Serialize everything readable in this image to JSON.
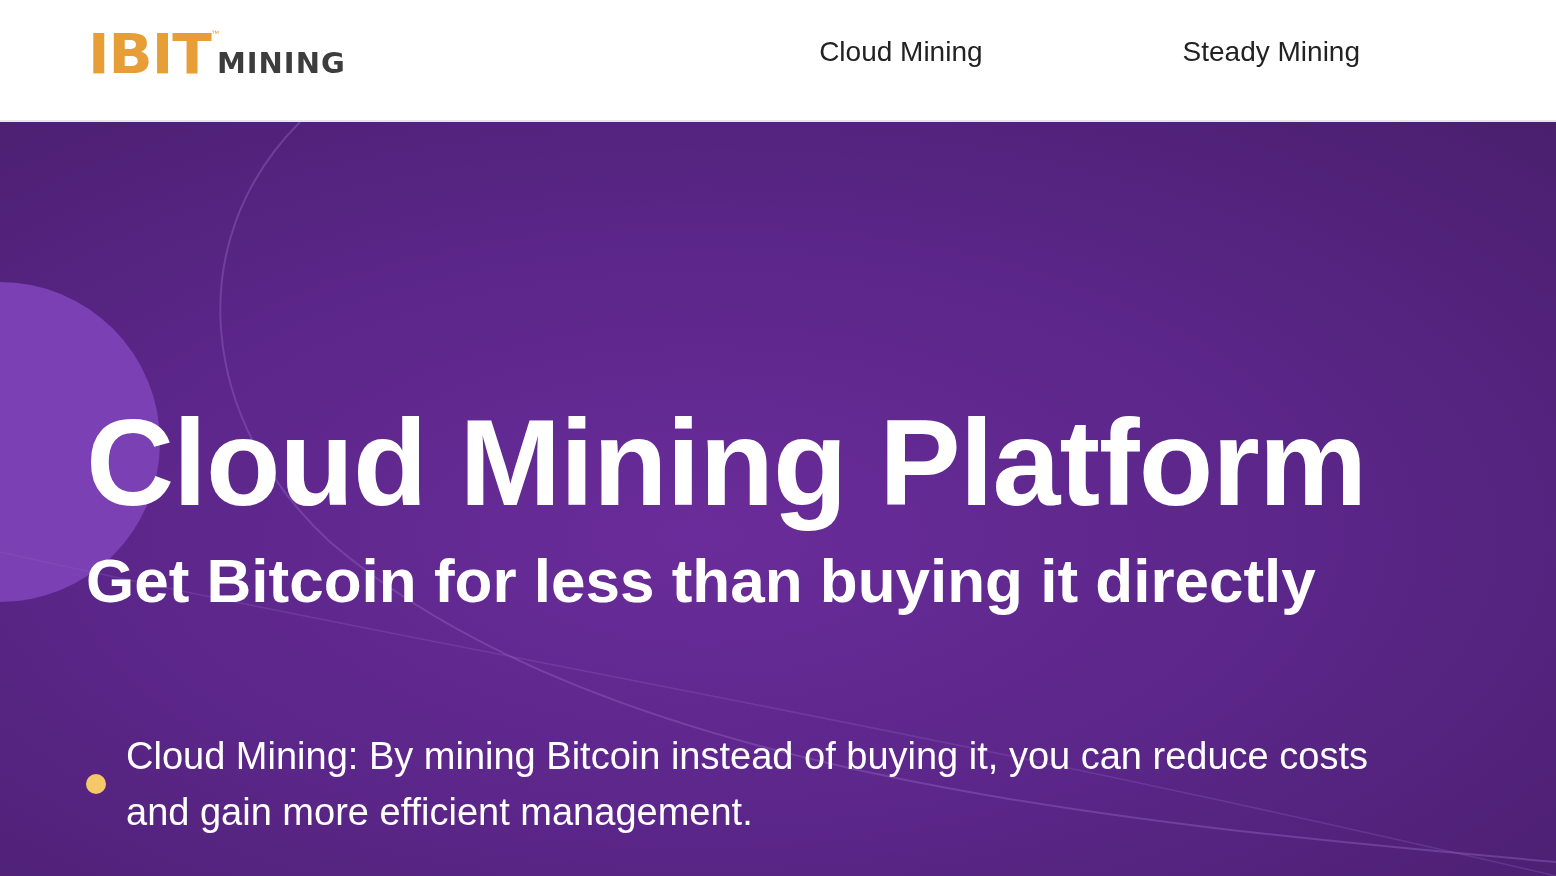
{
  "header": {
    "logo": {
      "primary": "IBIT",
      "trademark": "™",
      "secondary": "MINING"
    },
    "nav": [
      {
        "label": "Cloud Mining"
      },
      {
        "label": "Steady Mining"
      }
    ]
  },
  "hero": {
    "title": "Cloud Mining Platform",
    "subtitle": "Get Bitcoin for less than buying it directly",
    "bullets": [
      {
        "text": "Cloud Mining: By mining Bitcoin instead of buying it, you can reduce costs and gain more efficient management.",
        "color": "#f5c86a"
      }
    ]
  }
}
